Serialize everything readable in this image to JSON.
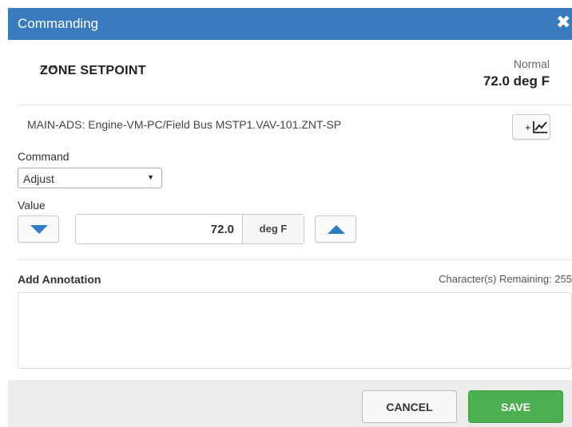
{
  "dialog": {
    "title": "Commanding",
    "close_glyph": "✖"
  },
  "point": {
    "id": "ZN-SP",
    "name": "ZONE SETPOINT",
    "status": "Normal",
    "present_value": "72.0 deg F",
    "path": "MAIN-ADS: Engine-VM-PC/Field Bus MSTP1.VAV-101.ZNT-SP"
  },
  "trend_button": {
    "label": "+",
    "icon": "trend-chart-icon"
  },
  "command": {
    "label": "Command",
    "selected": "Adjust",
    "arrow": "▼"
  },
  "value": {
    "label": "Value",
    "current": "72.0",
    "units": "deg F",
    "decrement_icon": "caret-down-icon",
    "increment_icon": "caret-up-icon"
  },
  "annotation": {
    "label": "Add Annotation",
    "remaining_text": "Character(s) Remaining: 255",
    "value": ""
  },
  "footer": {
    "cancel_label": "CANCEL",
    "save_label": "SAVE"
  },
  "colors": {
    "titlebar": "#3a7bbf",
    "save": "#4bae4f",
    "step_arrow": "#2e7cc4"
  }
}
